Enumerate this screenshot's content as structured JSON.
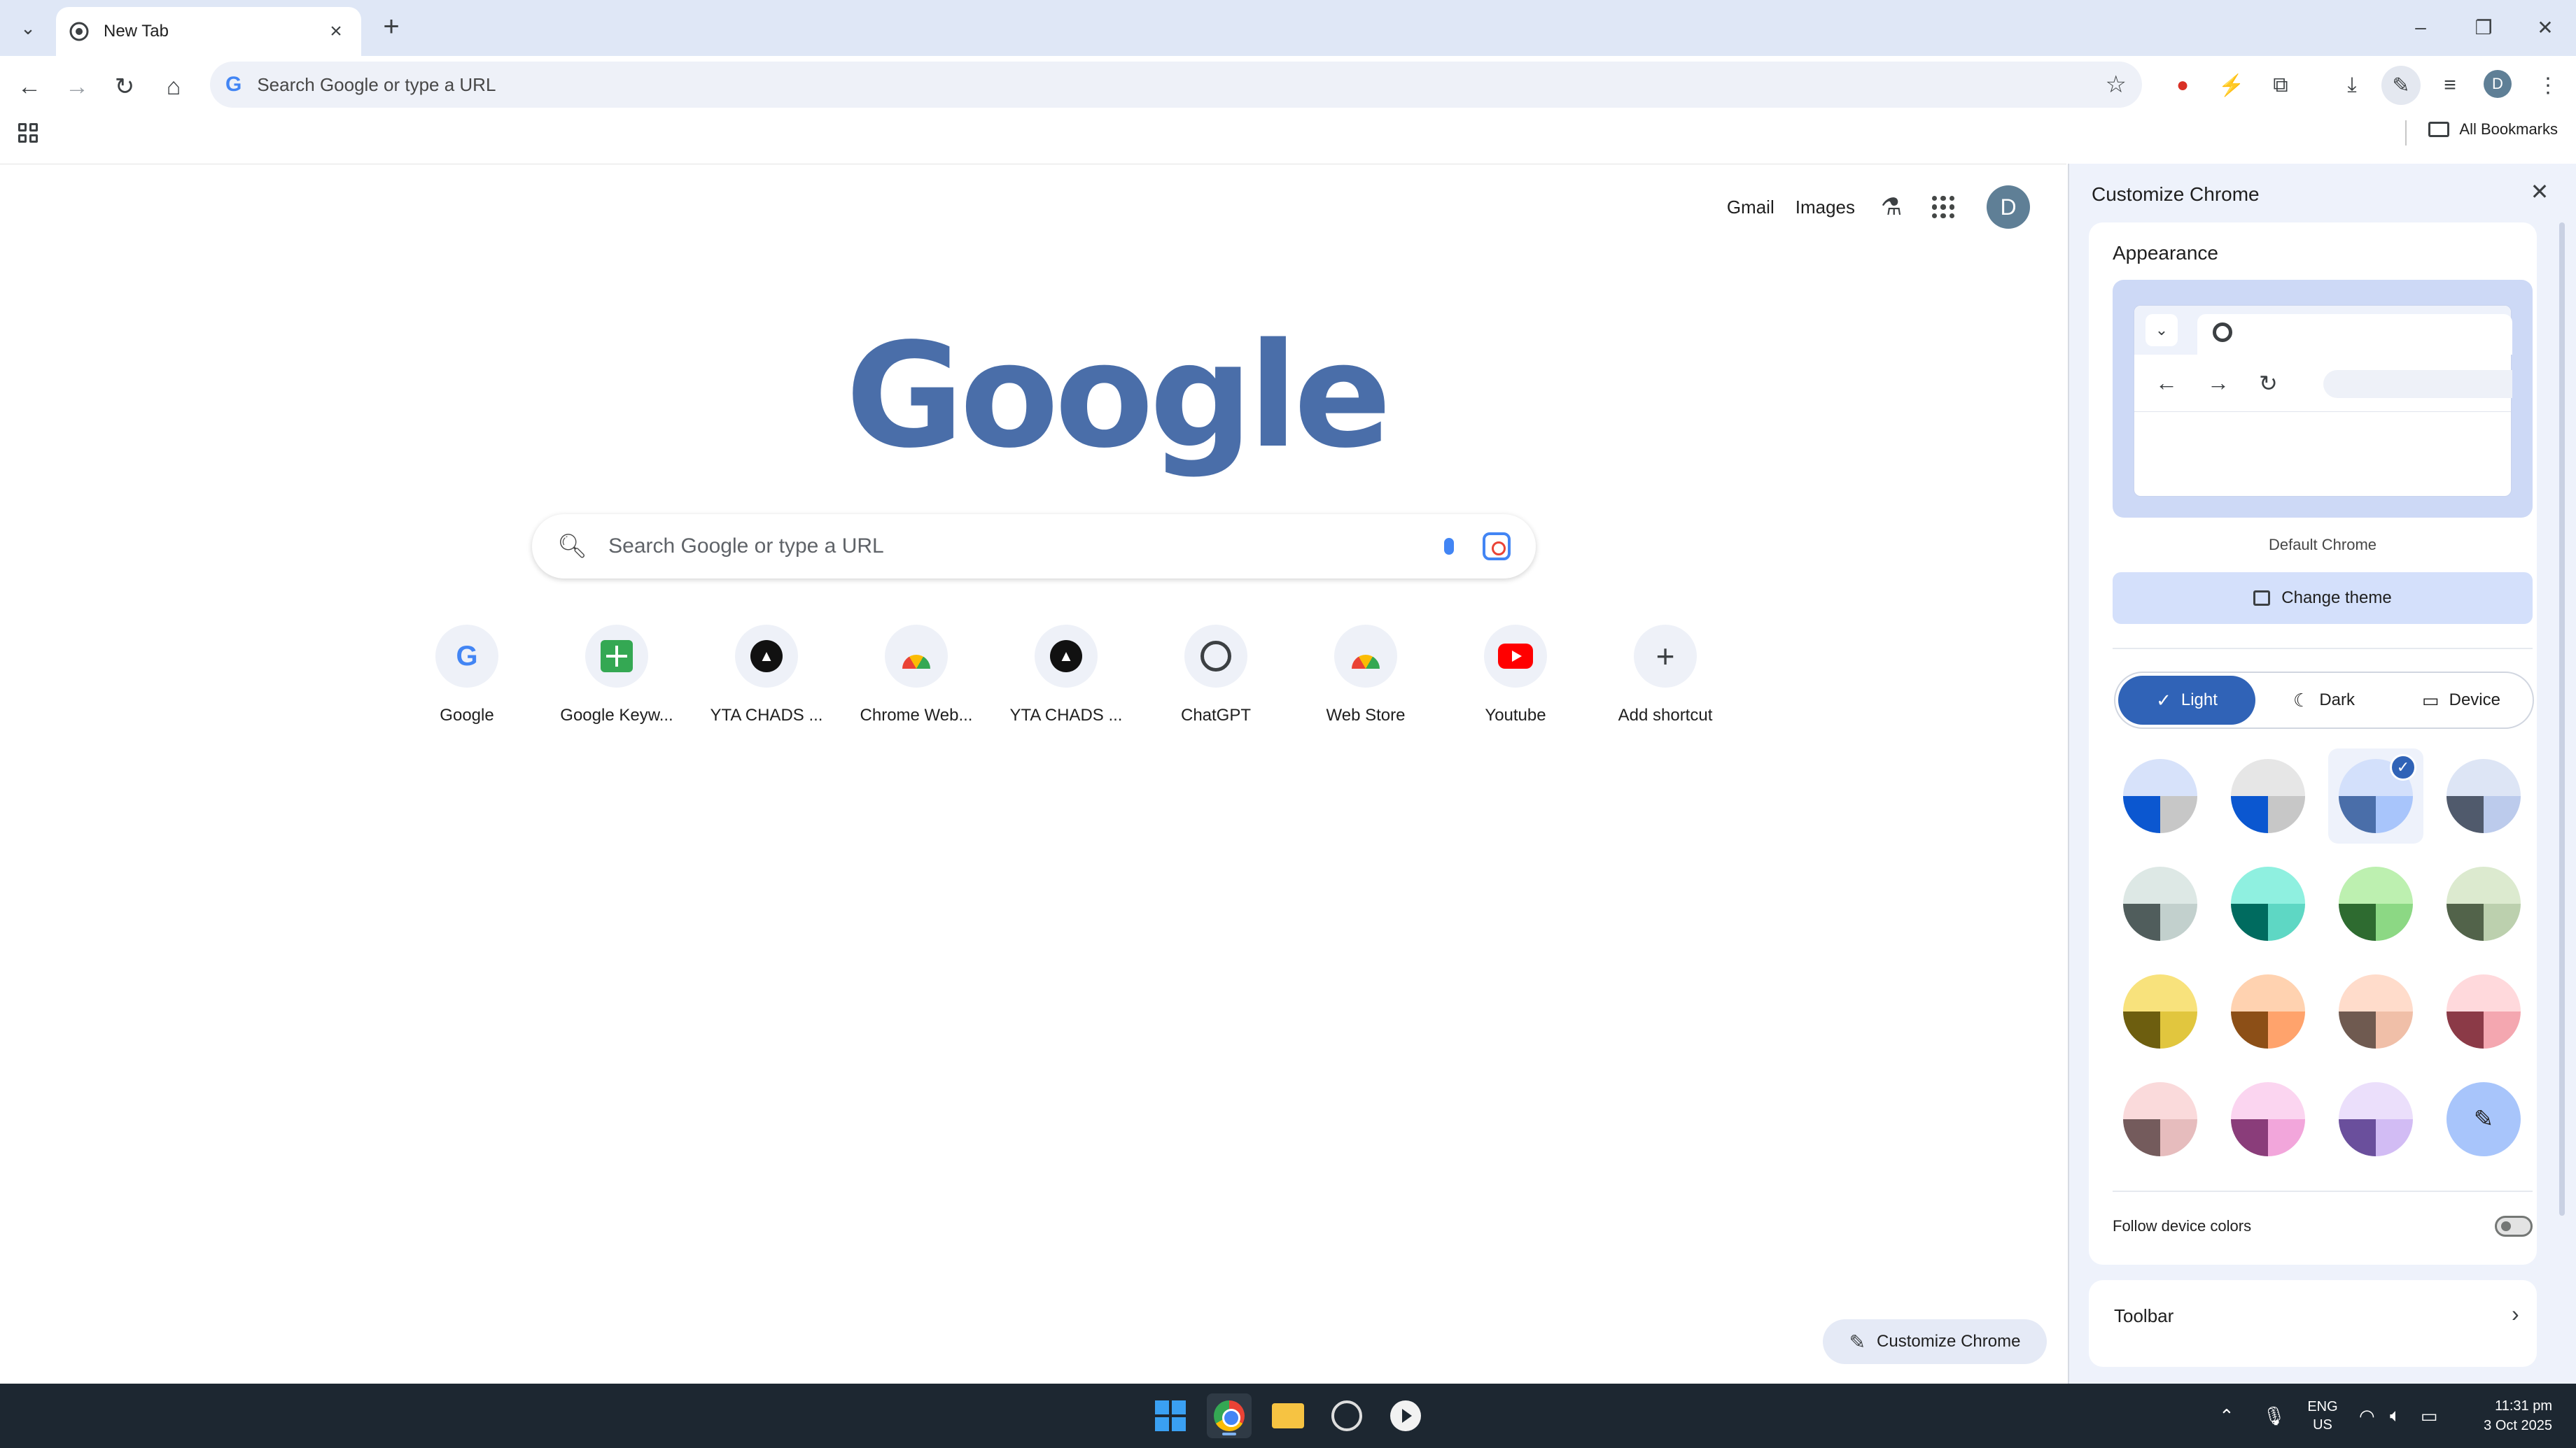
{
  "browser": {
    "tab_title": "New Tab",
    "omnibox_placeholder": "Search Google or type a URL",
    "bookmarks_label": "All Bookmarks"
  },
  "ntp": {
    "top_links": {
      "gmail": "Gmail",
      "images": "Images"
    },
    "avatar_letter": "D",
    "logo_text": "Google",
    "search_placeholder": "Search Google or type a URL",
    "shortcuts": [
      {
        "label": "Google",
        "icon": "google-icon"
      },
      {
        "label": "Google Keyw...",
        "icon": "sheets-icon"
      },
      {
        "label": "YTA CHADS ...",
        "icon": "yta-icon"
      },
      {
        "label": "Chrome Web...",
        "icon": "webstore-icon"
      },
      {
        "label": "YTA CHADS ...",
        "icon": "yta-icon"
      },
      {
        "label": "ChatGPT",
        "icon": "chatgpt-icon"
      },
      {
        "label": "Web Store",
        "icon": "webstore-icon"
      },
      {
        "label": "Youtube",
        "icon": "youtube-icon"
      },
      {
        "label": "Add shortcut",
        "icon": "plus-icon"
      }
    ],
    "customize_button": "Customize Chrome"
  },
  "side_panel": {
    "title": "Customize Chrome",
    "appearance_title": "Appearance",
    "theme_name": "Default Chrome",
    "change_theme": "Change theme",
    "modes": [
      {
        "label": "Light",
        "active": true
      },
      {
        "label": "Dark",
        "active": false
      },
      {
        "label": "Device",
        "active": false
      }
    ],
    "swatches": [
      {
        "top": "#d7e2fa",
        "left": "#0b57d0",
        "right": "#c7c7c7",
        "selected": false
      },
      {
        "top": "#e6e6e6",
        "left": "#0b57d0",
        "right": "#c7c7c7",
        "selected": false
      },
      {
        "top": "#d3e0fb",
        "left": "#4a6ea9",
        "right": "#a8c5fb",
        "selected": true
      },
      {
        "top": "#dde5f5",
        "left": "#505a6c",
        "right": "#bccbec",
        "selected": false
      },
      {
        "top": "#dde8e5",
        "left": "#505d5c",
        "right": "#c2d0cd",
        "selected": false
      },
      {
        "top": "#8ff0e0",
        "left": "#006b5f",
        "right": "#5ed7c4",
        "selected": false
      },
      {
        "top": "#bdf0b0",
        "left": "#2e6b30",
        "right": "#8cd884",
        "selected": false
      },
      {
        "top": "#dceacf",
        "left": "#52634a",
        "right": "#bcd0ae",
        "selected": false
      },
      {
        "top": "#f8e27c",
        "left": "#6d5e0f",
        "right": "#e1c63e",
        "selected": false
      },
      {
        "top": "#ffd2b0",
        "left": "#8c4f17",
        "right": "#ffa36c",
        "selected": false
      },
      {
        "top": "#ffdccb",
        "left": "#6f5a50",
        "right": "#f0bfa8",
        "selected": false
      },
      {
        "top": "#ffd9dc",
        "left": "#8b3a47",
        "right": "#f4a7b0",
        "selected": false
      },
      {
        "top": "#fadadb",
        "left": "#745b5c",
        "right": "#e6bcbd",
        "selected": false
      },
      {
        "top": "#fbd5f0",
        "left": "#8a3d7a",
        "right": "#f2a6db",
        "selected": false
      },
      {
        "top": "#ebdffb",
        "left": "#6a4f9c",
        "right": "#d2bcf4",
        "selected": false
      }
    ],
    "follow_device_colors": "Follow device colors",
    "toolbar_label": "Toolbar"
  },
  "taskbar": {
    "lang_top": "ENG",
    "lang_bottom": "US",
    "time": "11:31 pm",
    "date": "3 Oct 2025"
  }
}
